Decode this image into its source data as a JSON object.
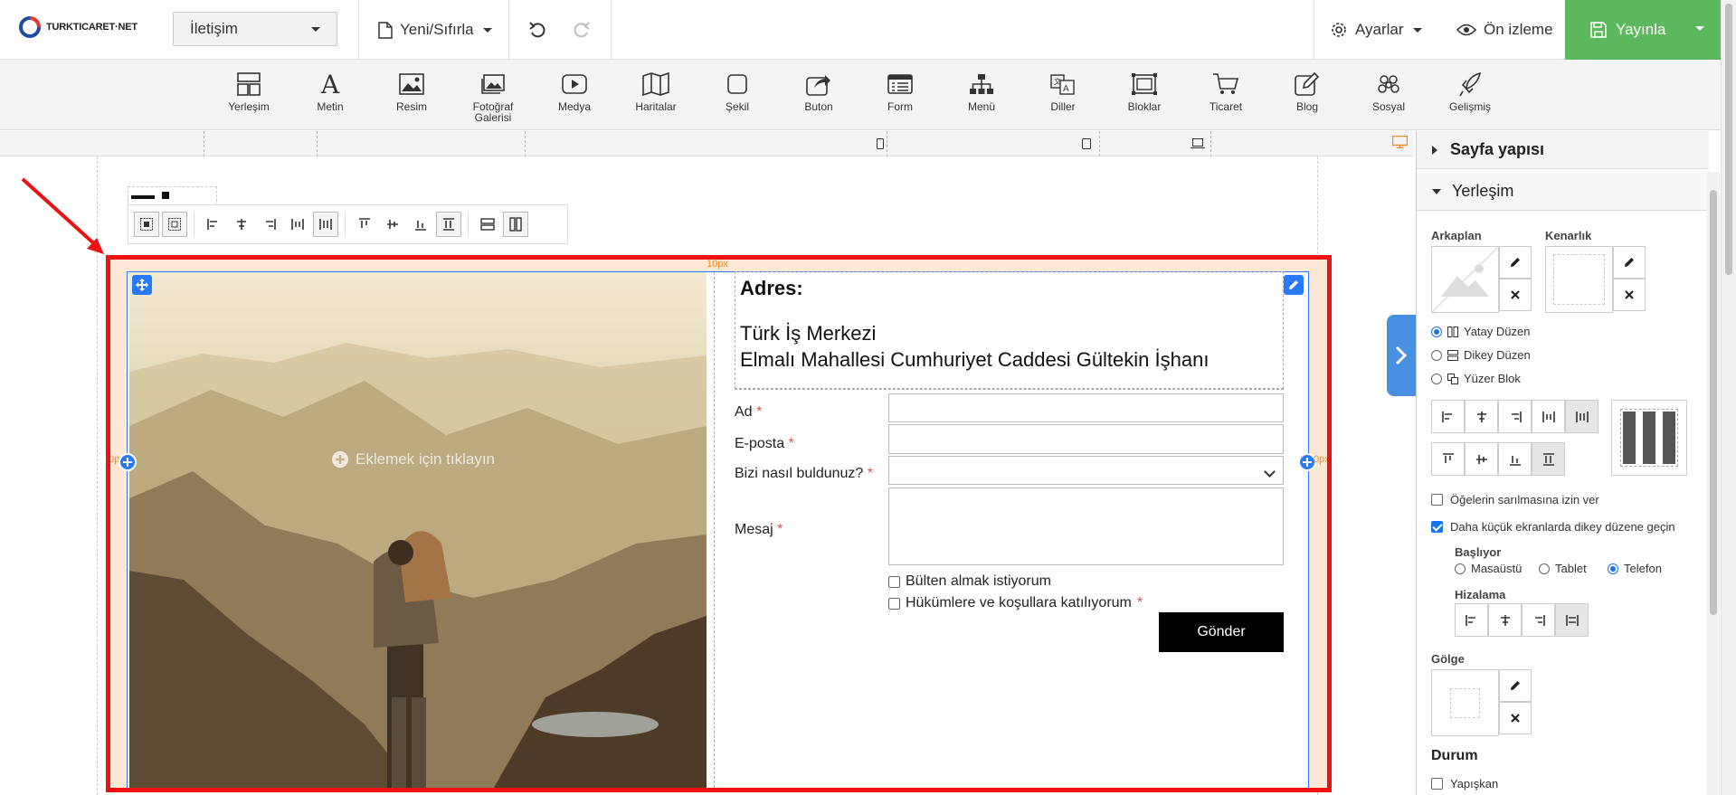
{
  "header": {
    "logo_text": "TURKTICARET·NET",
    "page_select": "İletişim",
    "new_reset": "Yeni/Sıfırla",
    "settings": "Ayarlar",
    "preview": "Ön izleme",
    "publish": "Yayınla"
  },
  "toolbar": [
    {
      "label": "Yerleşim",
      "icon": "layout-icon"
    },
    {
      "label": "Metin",
      "icon": "text-icon"
    },
    {
      "label": "Resim",
      "icon": "image-icon"
    },
    {
      "label": "Fotoğraf Galerisi",
      "icon": "gallery-icon"
    },
    {
      "label": "Medya",
      "icon": "media-icon"
    },
    {
      "label": "Haritalar",
      "icon": "map-icon"
    },
    {
      "label": "Şekil",
      "icon": "shape-icon"
    },
    {
      "label": "Buton",
      "icon": "button-icon"
    },
    {
      "label": "Form",
      "icon": "form-icon"
    },
    {
      "label": "Menü",
      "icon": "menu-icon"
    },
    {
      "label": "Diller",
      "icon": "languages-icon"
    },
    {
      "label": "Bloklar",
      "icon": "blocks-icon"
    },
    {
      "label": "Ticaret",
      "icon": "cart-icon"
    },
    {
      "label": "Blog",
      "icon": "blog-icon"
    },
    {
      "label": "Sosyal",
      "icon": "social-icon"
    },
    {
      "label": "Gelişmiş",
      "icon": "rocket-icon"
    }
  ],
  "canvas": {
    "padding_label": "10px",
    "side_label_left": "0px",
    "side_label_right": "0px",
    "add_hint": "Eklemek için tıklayın",
    "address": {
      "heading": "Adres:",
      "line1": "Türk İş Merkezi",
      "line2": "Elmalı Mahallesi Cumhuriyet Caddesi Gültekin İşhanı"
    },
    "form": {
      "name_label": "Ad",
      "email_label": "E-posta",
      "source_label": "Bizi nasıl buldunuz?",
      "message_label": "Mesaj",
      "required_mark": "*",
      "newsletter": "Bülten almak istiyorum",
      "terms": "Hükümlere ve koşullara katılıyorum",
      "submit": "Gönder"
    }
  },
  "panel": {
    "page_structure": "Sayfa yapısı",
    "layout": "Yerleşim",
    "background": "Arkaplan",
    "border": "Kenarlık",
    "layout_modes": [
      {
        "label": "Yatay Düzen",
        "selected": true
      },
      {
        "label": "Dikey Düzen",
        "selected": false
      },
      {
        "label": "Yüzer Blok",
        "selected": false
      }
    ],
    "wrap_items": "Öğelerin sarılmasına izin ver",
    "wrap_items_checked": false,
    "stack_small": "Daha küçük ekranlarda dikey düzene geçin",
    "stack_small_checked": true,
    "start_label": "Başlıyor",
    "devices": [
      {
        "label": "Masaüstü",
        "selected": false
      },
      {
        "label": "Tablet",
        "selected": false
      },
      {
        "label": "Telefon",
        "selected": true
      }
    ],
    "alignment": "Hizalama",
    "shadow": "Gölge",
    "status": "Durum",
    "sticky": "Yapışkan",
    "sticky_checked": false
  },
  "colors": {
    "publish_green": "#5cb85c",
    "accent_blue": "#2979ff",
    "highlight_red": "#e11111",
    "padding_orange": "#f08a24"
  }
}
